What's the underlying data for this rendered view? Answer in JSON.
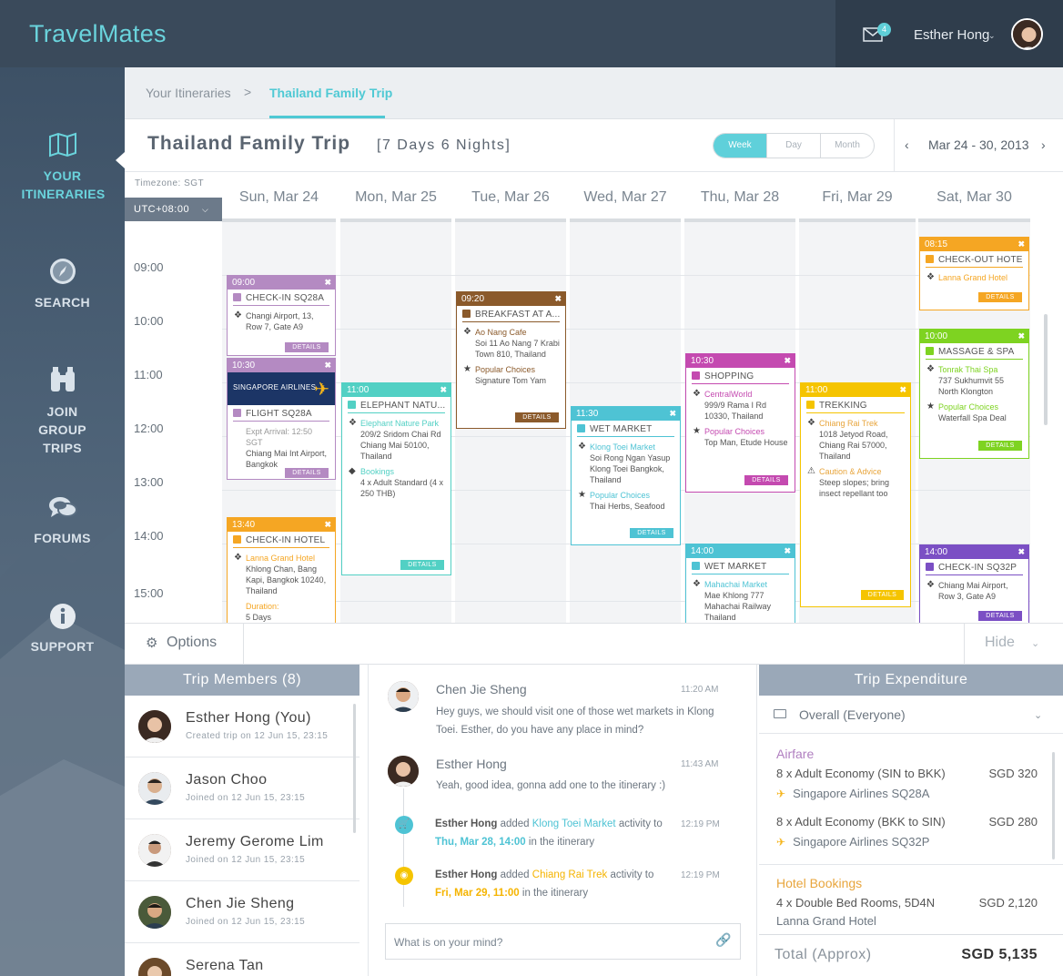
{
  "app": {
    "brand": "TravelMates",
    "mail_count": "4",
    "user_name": "Esther Hong"
  },
  "sidebar": {
    "items": [
      {
        "label": "YOUR ITINERARIES",
        "icon": "map-icon"
      },
      {
        "label": "SEARCH",
        "icon": "compass-icon"
      },
      {
        "label": "JOIN GROUP TRIPS",
        "icon": "binoculars-icon"
      },
      {
        "label": "FORUMS",
        "icon": "chat-bubbles-icon"
      },
      {
        "label": "SUPPORT",
        "icon": "info-icon"
      }
    ]
  },
  "breadcrumb": {
    "parent": "Your Itineraries",
    "separator": ">",
    "current": "Thailand Family Trip"
  },
  "trip": {
    "title": "Thailand Family Trip",
    "duration": "[7 Days 6 Nights]"
  },
  "view_toggle": {
    "options": [
      "Week",
      "Day",
      "Month"
    ],
    "selected": "Week"
  },
  "date_range": "Mar 24 - 30, 2013",
  "timezone": {
    "label": "Timezone: SGT",
    "value": "UTC+08:00"
  },
  "calendar": {
    "days": [
      "Sun, Mar 24",
      "Mon, Mar 25",
      "Tue, Mar 26",
      "Wed, Mar 27",
      "Thu, Mar 28",
      "Fri, Mar 29",
      "Sat, Mar 30"
    ],
    "hours": [
      "09:00",
      "10:00",
      "11:00",
      "12:00",
      "13:00",
      "14:00",
      "15:00"
    ]
  },
  "events": [
    {
      "time": "09:00",
      "title": "CHECK-IN SQ28A",
      "color": "#b48ac2",
      "rows": [
        {
          "sym": "pin",
          "text": "Changi Airport, 13, Row 7, Gate A9"
        }
      ],
      "button": "DETAILS"
    },
    {
      "time": "10:30",
      "title": "FLIGHT SQ28A",
      "color": "#b48ac2",
      "banner": "SINGAPORE AIRLINES",
      "rows": [
        {
          "note": "Expt Arrival: 12:50 SGT",
          "text": "Chiang Mai Int Airport, Bangkok"
        }
      ],
      "button": "DETAILS"
    },
    {
      "time": "13:40",
      "title": "CHECK-IN HOTEL",
      "color": "#f5a623",
      "rows": [
        {
          "sym": "pin",
          "hl": "Lanna Grand Hotel",
          "text": "Khlong Chan, Bang Kapi, Bangkok 10240, Thailand"
        },
        {
          "hl": "Duration:",
          "text": "5 Days"
        }
      ]
    },
    {
      "time": "11:00",
      "title": "ELEPHANT NATU...",
      "color": "#52d0c4",
      "rows": [
        {
          "sym": "pin",
          "hl": "Elephant Nature Park",
          "text": "209/2 Sridom Chai Rd Chiang Mai 50100, Thailand"
        },
        {
          "sym": "tag",
          "hl": "Bookings",
          "text": "4 x Adult Standard (4 x 250 THB)"
        }
      ],
      "button": "DETAILS"
    },
    {
      "time": "09:20",
      "title": "BREAKFAST AT A...",
      "color": "#8b5a2b",
      "rows": [
        {
          "sym": "pin",
          "hl": "Ao Nang Cafe",
          "text": "Soi 11 Ao Nang 7 Krabi Town 810, Thailand"
        },
        {
          "sym": "star",
          "hl": "Popular Choices",
          "text": "Signature Tom Yam"
        }
      ],
      "button": "DETAILS"
    },
    {
      "time": "11:30",
      "title": "WET MARKET",
      "color": "#4ec3d4",
      "rows": [
        {
          "sym": "pin",
          "hl": "Klong Toei Market",
          "text": "Soi Rong Ngan Yasup Klong Toei Bangkok, Thailand"
        },
        {
          "sym": "star",
          "hl": "Popular Choices",
          "text": "Thai Herbs, Seafood"
        }
      ],
      "button": "DETAILS"
    },
    {
      "time": "10:30",
      "title": "SHOPPING",
      "color": "#c44ab0",
      "rows": [
        {
          "sym": "pin",
          "hl": "CentralWorld",
          "text": "999/9 Rama I Rd 10330, Thailand"
        },
        {
          "sym": "star",
          "hl": "Popular Choices",
          "text": "Top Man, Etude House"
        }
      ],
      "button": "DETAILS"
    },
    {
      "time": "14:00",
      "title": "WET MARKET",
      "color": "#4ec3d4",
      "rows": [
        {
          "sym": "pin",
          "hl": "Mahachai Market",
          "text": "Mae Khlong 777 Mahachai Railway Thailand"
        }
      ]
    },
    {
      "time": "11:00",
      "title": "TREKKING",
      "color": "#f5c400",
      "rows": [
        {
          "sym": "pin",
          "hl": "Chiang Rai Trek",
          "text": "1018 Jetyod Road, Chiang Rai 57000, Thailand"
        },
        {
          "sym": "warn",
          "hl": "Caution & Advice",
          "text": "Steep slopes; bring insect repellant too"
        }
      ],
      "button": "DETAILS"
    },
    {
      "time": "08:15",
      "title": "CHECK-OUT HOTEL",
      "color": "#f5a623",
      "rows": [
        {
          "sym": "pin",
          "hl": "Lanna Grand Hotel",
          "text": ""
        }
      ],
      "button": "DETAILS"
    },
    {
      "time": "10:00",
      "title": "MASSAGE & SPA",
      "color": "#7ed321",
      "rows": [
        {
          "sym": "pin",
          "hl": "Tonrak Thai Spa",
          "text": "737 Sukhumvit 55 North Klongton"
        },
        {
          "sym": "star",
          "hl": "Popular Choices",
          "text": "Waterfall Spa Deal"
        }
      ],
      "button": "DETAILS"
    },
    {
      "time": "14:00",
      "title": "CHECK-IN SQ32P",
      "color": "#7b4fc4",
      "rows": [
        {
          "sym": "pin",
          "text": "Chiang Mai Airport, Row 3, Gate A9"
        }
      ],
      "button": "DETAILS"
    }
  ],
  "options_bar": {
    "options_label": "Options",
    "hide_label": "Hide"
  },
  "members": {
    "title": "Trip Members (8)",
    "list": [
      {
        "name": "Esther Hong (You)",
        "sub": "Created trip on 12 Jun 15, 23:15"
      },
      {
        "name": "Jason Choo",
        "sub": "Joined on 12 Jun 15, 23:15"
      },
      {
        "name": "Jeremy Gerome Lim",
        "sub": "Joined on 12 Jun 15, 23:15"
      },
      {
        "name": "Chen Jie Sheng",
        "sub": "Joined on 12 Jun 15, 23:15"
      },
      {
        "name": "Serena Tan",
        "sub": ""
      }
    ]
  },
  "chat": {
    "messages": [
      {
        "name": "Chen Jie Sheng",
        "time": "11:20 AM",
        "text": "Hey guys, we should visit one of those wet markets in Klong Toei. Esther, do you have any place in mind?"
      },
      {
        "name": "Esther Hong",
        "time": "11:43 AM",
        "text": "Yeah, good idea, gonna add one to the itinerary :)"
      }
    ],
    "activities": [
      {
        "who": "Esther Hong",
        "added": "added",
        "what": "Klong Toei Market",
        "mid": "activity to",
        "when": "Thu, Mar 28, 14:00",
        "tail": "in the itinerary",
        "time": "12:19 PM",
        "color": "#4ec3d4"
      },
      {
        "who": "Esther Hong",
        "added": "added",
        "what": "Chiang Rai Trek",
        "mid": "activity to",
        "when": "Fri, Mar 29, 11:00",
        "tail": "in the itinerary",
        "time": "12:19 PM",
        "color": "#f5c400"
      }
    ],
    "input_placeholder": "What is on your mind?"
  },
  "expenditure": {
    "title": "Trip Expenditure",
    "filter": "Overall (Everyone)",
    "airfare_label": "Airfare",
    "air_items": [
      {
        "desc": "8 x Adult Economy (SIN to BKK)",
        "amount": "SGD 320",
        "sub": "Singapore Airlines SQ28A"
      },
      {
        "desc": "8 x Adult Economy (BKK to SIN)",
        "amount": "SGD 280",
        "sub": "Singapore Airlines SQ32P"
      }
    ],
    "hotel_label": "Hotel Bookings",
    "hotel_items": [
      {
        "desc": "4 x Double Bed Rooms, 5D4N",
        "amount": "SGD 2,120",
        "sub": "Lanna Grand Hotel"
      }
    ],
    "total_label": "Total (Approx)",
    "total_amount": "SGD 5,135"
  }
}
